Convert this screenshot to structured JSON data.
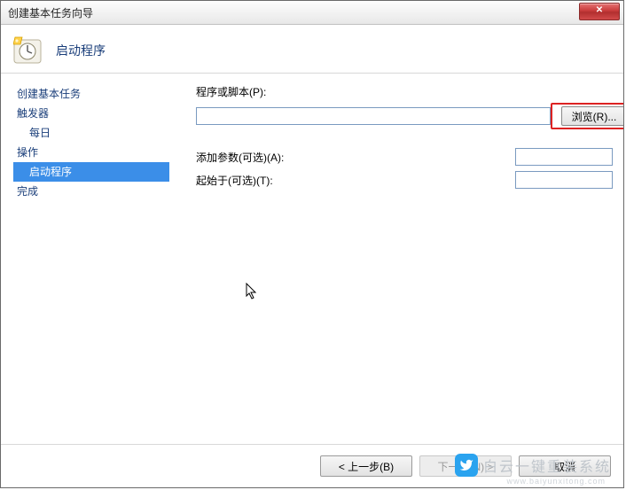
{
  "window": {
    "title": "创建基本任务向导",
    "close_glyph": "✕"
  },
  "header": {
    "title": "启动程序"
  },
  "sidebar": {
    "items": [
      {
        "label": "创建基本任务",
        "indent": false,
        "selected": false
      },
      {
        "label": "触发器",
        "indent": false,
        "selected": false
      },
      {
        "label": "每日",
        "indent": true,
        "selected": false
      },
      {
        "label": "操作",
        "indent": false,
        "selected": false
      },
      {
        "label": "启动程序",
        "indent": true,
        "selected": true
      },
      {
        "label": "完成",
        "indent": false,
        "selected": false
      }
    ]
  },
  "form": {
    "program_label": "程序或脚本(P):",
    "program_value": "",
    "browse_label": "浏览(R)...",
    "args_label": "添加参数(可选)(A):",
    "args_value": "",
    "startin_label": "起始于(可选)(T):",
    "startin_value": ""
  },
  "footer": {
    "back": "< 上一步(B)",
    "next": "下一步(N) >",
    "cancel": "取消"
  },
  "watermark": {
    "text": "白云一键重装系统",
    "url": "www.baiyunxitong.com"
  }
}
